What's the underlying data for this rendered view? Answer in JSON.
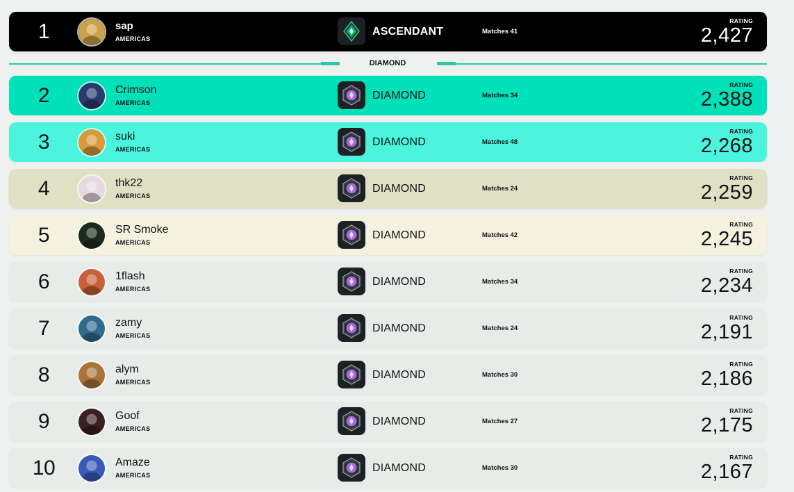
{
  "leaderboard": {
    "section_label": "DIAMOND",
    "rating_label": "RATING",
    "entries": [
      {
        "rank": "1",
        "name": "sap",
        "region": "AMERICAS",
        "tier": "ASCENDANT",
        "tier_icon": "ascendant-icon",
        "matches": "Matches 41",
        "rating": "2,427",
        "bg": "#000000",
        "avatar_color": "#c9a24a"
      },
      {
        "rank": "2",
        "name": "Crimson",
        "region": "AMERICAS",
        "tier": "DIAMOND",
        "tier_icon": "diamond-icon",
        "matches": "Matches 34",
        "rating": "2,388",
        "bg": "#00e0b9",
        "avatar_color": "#2b3a6e"
      },
      {
        "rank": "3",
        "name": "suki",
        "region": "AMERICAS",
        "tier": "DIAMOND",
        "tier_icon": "diamond-icon",
        "matches": "Matches 48",
        "rating": "2,268",
        "bg": "#4cf4de",
        "avatar_color": "#d89a3a"
      },
      {
        "rank": "4",
        "name": "thk22",
        "region": "AMERICAS",
        "tier": "DIAMOND",
        "tier_icon": "diamond-icon",
        "matches": "Matches 24",
        "rating": "2,259",
        "bg": "#e0e0c4",
        "avatar_color": "#e8d8e0"
      },
      {
        "rank": "5",
        "name": "SR Smoke",
        "region": "AMERICAS",
        "tier": "DIAMOND",
        "tier_icon": "diamond-icon",
        "matches": "Matches 42",
        "rating": "2,245",
        "bg": "#f4f1de",
        "avatar_color": "#1d2a1e"
      },
      {
        "rank": "6",
        "name": "1flash",
        "region": "AMERICAS",
        "tier": "DIAMOND",
        "tier_icon": "diamond-icon",
        "matches": "Matches 34",
        "rating": "2,234",
        "bg": "#e8ece9",
        "avatar_color": "#c8603a"
      },
      {
        "rank": "7",
        "name": "zamy",
        "region": "AMERICAS",
        "tier": "DIAMOND",
        "tier_icon": "diamond-icon",
        "matches": "Matches 24",
        "rating": "2,191",
        "bg": "#e8ece9",
        "avatar_color": "#2f6b8c"
      },
      {
        "rank": "8",
        "name": "alym",
        "region": "AMERICAS",
        "tier": "DIAMOND",
        "tier_icon": "diamond-icon",
        "matches": "Matches 30",
        "rating": "2,186",
        "bg": "#e8ece9",
        "avatar_color": "#a8743a"
      },
      {
        "rank": "9",
        "name": "Goof",
        "region": "AMERICAS",
        "tier": "DIAMOND",
        "tier_icon": "diamond-icon",
        "matches": "Matches 27",
        "rating": "2,175",
        "bg": "#e8ece9",
        "avatar_color": "#3a1e22"
      },
      {
        "rank": "10",
        "name": "Amaze",
        "region": "AMERICAS",
        "tier": "DIAMOND",
        "tier_icon": "diamond-icon",
        "matches": "Matches 30",
        "rating": "2,167",
        "bg": "#e8ece9",
        "avatar_color": "#3a5ab8"
      }
    ]
  },
  "colors": {
    "accent": "#2ec7a6",
    "diamond_gem": "#a66ad8",
    "ascendant_gem": "#1fa86a",
    "icon_bg": "#1c2126"
  }
}
